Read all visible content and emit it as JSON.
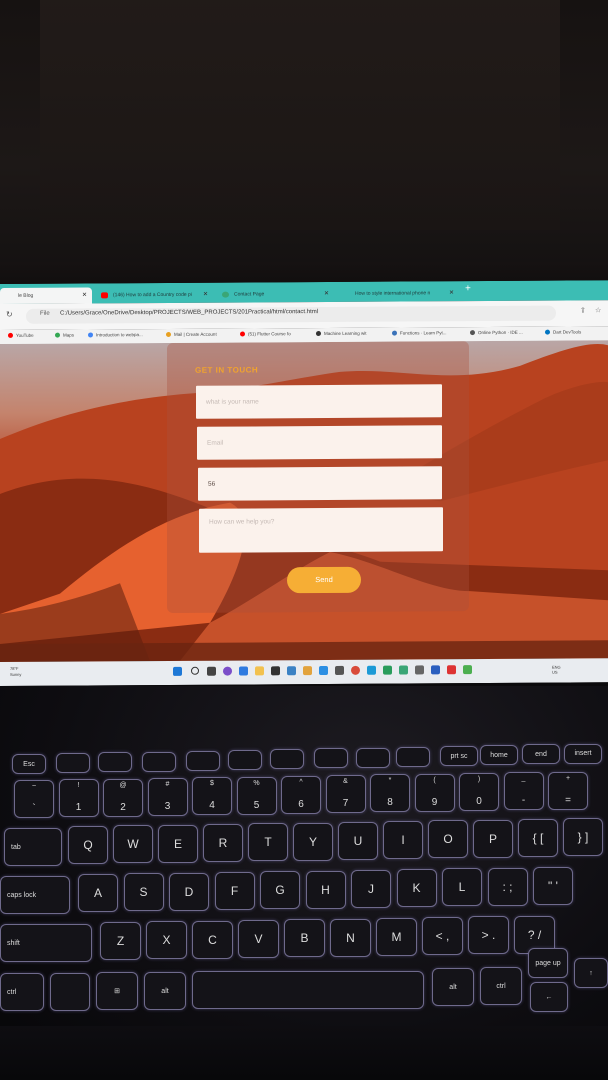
{
  "browser": {
    "tabs": [
      {
        "label": "le Blog",
        "color": "#f2f5f5"
      },
      {
        "label": "(146) How to add a Country code pi",
        "color": "#ff0000"
      },
      {
        "label": "Contact Page",
        "color": "#3aa676"
      },
      {
        "label": "How to style international phone n",
        "color": "#cccccc"
      }
    ],
    "new_tab": "+",
    "file_label": "File",
    "url": "C:/Users/Grace/OneDrive/Desktop/PROJECTS/WEB_PROJECTS/201Practical/html/contact.html",
    "bookmarks": [
      {
        "label": "YouTube",
        "color": "#ff0000"
      },
      {
        "label": "Maps",
        "color": "#34a853"
      },
      {
        "label": "Introduction to webpa...",
        "color": "#4285f4"
      },
      {
        "label": "Mail | Create Account",
        "color": "#e8a020"
      },
      {
        "label": "(51) Flutter Course fo",
        "color": "#ff0000"
      },
      {
        "label": "Machine Learning wit",
        "color": "#333333"
      },
      {
        "label": "Functions · Learn Pyt...",
        "color": "#3b73b9"
      },
      {
        "label": "Online Python · IDE ...",
        "color": "#555555"
      },
      {
        "label": "Dart DevTools",
        "color": "#0175c2"
      }
    ]
  },
  "form": {
    "heading": "GET IN TOUCH",
    "name_placeholder": "what is your name",
    "email_placeholder": "Email",
    "phone_value": "56",
    "message_placeholder": "How can we help you?",
    "send_label": "Send"
  },
  "taskbar": {
    "weather_temp": "78°F",
    "weather_desc": "Sunny",
    "language": "ENG",
    "region": "US"
  },
  "keyboard": {
    "row_fn": [
      "Esc",
      "",
      "",
      "",
      "",
      "",
      "",
      "",
      "",
      "",
      "prt sc",
      "home",
      "end",
      "insert"
    ],
    "row_num": [
      {
        "top": "~",
        "bot": "`"
      },
      {
        "top": "!",
        "bot": "1"
      },
      {
        "top": "@",
        "bot": "2"
      },
      {
        "top": "#",
        "bot": "3"
      },
      {
        "top": "$",
        "bot": "4"
      },
      {
        "top": "%",
        "bot": "5"
      },
      {
        "top": "^",
        "bot": "6"
      },
      {
        "top": "&",
        "bot": "7"
      },
      {
        "top": "*",
        "bot": "8"
      },
      {
        "top": "(",
        "bot": "9"
      },
      {
        "top": ")",
        "bot": "0"
      },
      {
        "top": "_",
        "bot": "-"
      },
      {
        "top": "+",
        "bot": "="
      }
    ],
    "tab": "tab",
    "row_q": [
      "Q",
      "W",
      "E",
      "R",
      "T",
      "Y",
      "U",
      "I",
      "O",
      "P",
      "{ [",
      "} ]"
    ],
    "caps": "caps lock",
    "row_a": [
      "A",
      "S",
      "D",
      "F",
      "G",
      "H",
      "J",
      "K",
      "L",
      ": ;",
      "\" '"
    ],
    "shift": "shift",
    "row_z": [
      "Z",
      "X",
      "C",
      "V",
      "B",
      "N",
      "M",
      "< ,",
      "> .",
      "? /"
    ],
    "ctrl": "ctrl",
    "alt": "alt",
    "alt_right": "alt",
    "ctrl_right": "ctrl",
    "page_up": "page up"
  },
  "colors": {
    "tab_bar": "#3cbdb4",
    "heading": "#f0a32e",
    "send_button": "#f6ae35",
    "key_glow": "#6f6a8c"
  }
}
